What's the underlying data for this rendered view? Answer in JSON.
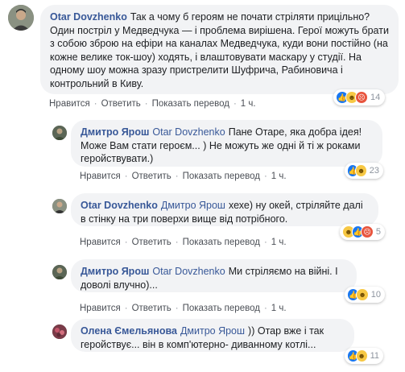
{
  "comments": [
    {
      "author": "Otar Dovzhenko",
      "mention": "",
      "text": "Так а чому б героям не почати стріляти прицільно? Один постріл у Медведчука — і проблема вирішена. Герої можуть брати з собою зброю на ефіри на каналах Медведчука, куди вони постійно (на кожне велике ток-шоу) ходять, і влаштовувати маскару у студії. На одному шоу можна зразу пристрелити Шуфрича, Рабиновича і контрольний в Киву.",
      "like": "Нравится",
      "reply": "Ответить",
      "translate": "Показать перевод",
      "time": "1 ч.",
      "reaction_count": "14",
      "reactions": [
        "like-icon",
        "haha-icon",
        "angry-icon"
      ]
    },
    {
      "author": "Дмитро Ярош",
      "mention": "Otar Dovzhenko",
      "text": "Пане Отаре, яка добра ідея! Може Вам стати героєм... ) Не можуть же одні й ті ж роками геройствувати.)",
      "like": "Нравится",
      "reply": "Ответить",
      "translate": "Показать перевод",
      "time": "1 ч.",
      "reaction_count": "23",
      "reactions": [
        "like-icon",
        "haha-icon"
      ]
    },
    {
      "author": "Otar Dovzhenko",
      "mention": "Дмитро Ярош",
      "text": "хехе) ну окей, стріляйте далі в стінку на три поверхи вище від потрібного.",
      "like": "Нравится",
      "reply": "Ответить",
      "translate": "Показать перевод",
      "time": "1 ч.",
      "reaction_count": "5",
      "reactions": [
        "haha-icon",
        "like-icon",
        "angry-icon"
      ]
    },
    {
      "author": "Дмитро Ярош",
      "mention": "Otar Dovzhenko",
      "text": "Ми стріляємо на війні. І доволі влучно)...",
      "like": "Нравится",
      "reply": "Ответить",
      "translate": "Показать перевод",
      "time": "1 ч.",
      "reaction_count": "10",
      "reactions": [
        "like-icon",
        "haha-icon"
      ]
    },
    {
      "author": "Олена Ємельянова",
      "mention": "Дмитро Ярош",
      "text": ")) Отар вже і так геройствує... він в комп'ютерно- диванному котлі...",
      "like": "Нравится",
      "reply": "Ответить",
      "translate": "Показать перевод",
      "time": "1 ч.",
      "reaction_count": "11",
      "reactions": [
        "like-icon",
        "haha-icon"
      ]
    }
  ],
  "colors": {
    "link": "#385898",
    "bubble": "#f2f3f5",
    "meta": "#606770"
  }
}
